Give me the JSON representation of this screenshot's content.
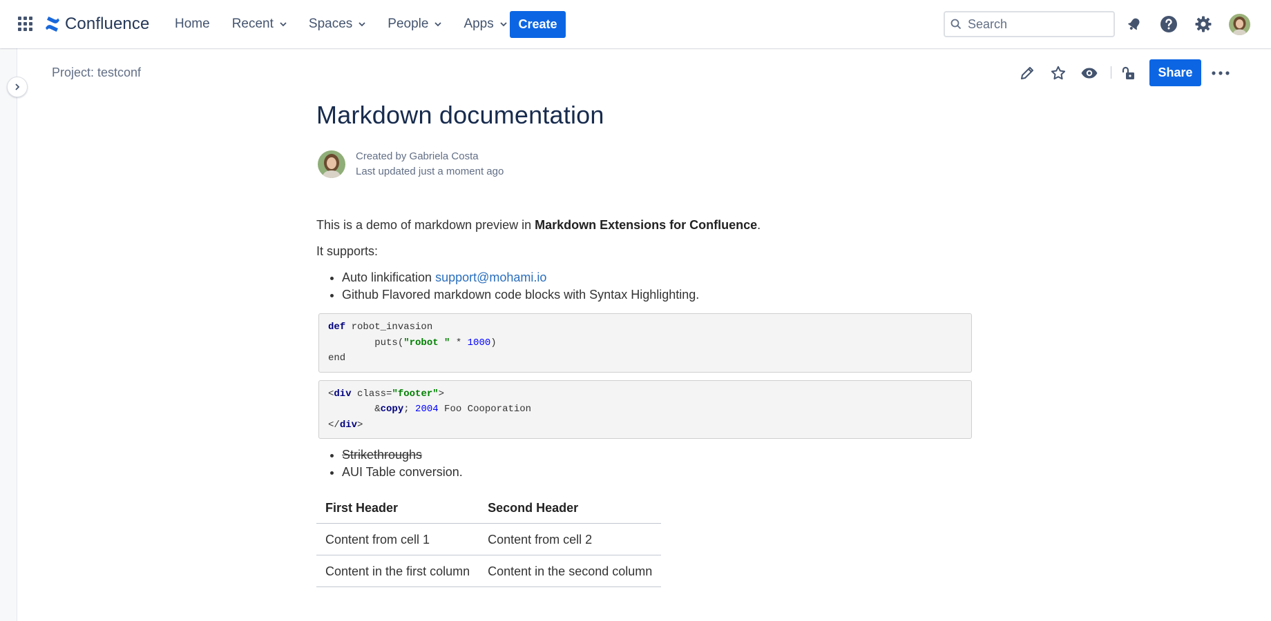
{
  "topnav": {
    "logo_text": "Confluence",
    "items": [
      {
        "label": "Home",
        "has_dropdown": false
      },
      {
        "label": "Recent",
        "has_dropdown": true
      },
      {
        "label": "Spaces",
        "has_dropdown": true
      },
      {
        "label": "People",
        "has_dropdown": true
      },
      {
        "label": "Apps",
        "has_dropdown": true
      }
    ],
    "create_label": "Create",
    "search_placeholder": "Search",
    "icons": [
      "app-switcher-icon",
      "notifications-icon",
      "help-icon",
      "settings-icon",
      "profile-avatar"
    ]
  },
  "page_header": {
    "breadcrumb": "Project: testconf",
    "share_label": "Share",
    "action_icons": [
      "edit-icon",
      "star-icon",
      "watch-icon",
      "restrictions-icon",
      "more-icon"
    ]
  },
  "page": {
    "title": "Markdown documentation",
    "byline": {
      "created_prefix": "Created by ",
      "author": "Gabriela Costa",
      "updated": "Last updated just a moment ago"
    },
    "intro": {
      "before": "This is a demo of markdown preview in ",
      "bold": "Markdown Extensions for Confluence",
      "after": "."
    },
    "supports_label": "It supports:",
    "list1": {
      "item1_text": "Auto linkification ",
      "item1_link": "support@mohami.io",
      "item2_text": "Github Flavored markdown code blocks with Syntax Highlighting."
    },
    "code1": {
      "l1_kw": "def",
      "l1_rest": " robot_invasion",
      "l2_pre": "        puts(",
      "l2_str": "\"robot \"",
      "l2_mid": " * ",
      "l2_num": "1000",
      "l2_post": ")",
      "l3": "end"
    },
    "code2": {
      "l1_open": "<",
      "l1_tag": "div",
      "l1_attr": " class=",
      "l1_val": "\"footer\"",
      "l1_close": ">",
      "l2_pre": "        &",
      "l2_ent": "copy",
      "l2_semi": "; ",
      "l2_num": "2004",
      "l2_rest": " Foo Cooporation",
      "l3_open": "</",
      "l3_tag": "div",
      "l3_close": ">"
    },
    "list2": {
      "item1": "Strikethroughs",
      "item2": "AUI Table conversion."
    },
    "table": {
      "headers": [
        "First Header",
        "Second Header"
      ],
      "rows": [
        [
          "Content from cell 1",
          "Content from cell 2"
        ],
        [
          "Content in the first column",
          "Content in the second column"
        ]
      ]
    }
  },
  "colors": {
    "brand_blue": "#0c66e4",
    "link_blue": "#2a6ebb",
    "code_keyword": "#000080",
    "code_string": "#008000",
    "code_number": "#0000ff"
  }
}
